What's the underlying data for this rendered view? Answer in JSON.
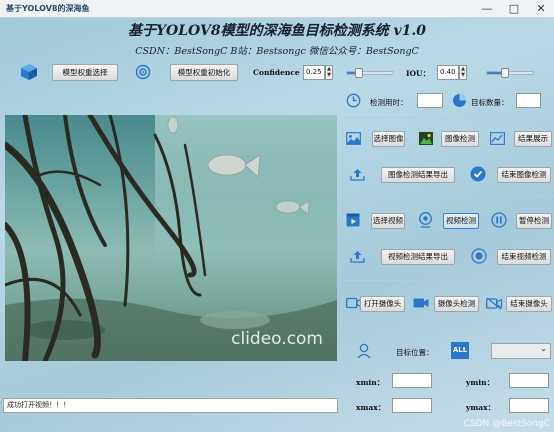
{
  "window": {
    "title": "基于YOLOV8的深海鱼",
    "min_glyph": "—",
    "max_glyph": "□",
    "close_glyph": "✕"
  },
  "header": {
    "title": "基于YOLOV8模型的深海鱼目标检测系统 v1.0",
    "subtitle": "CSDN：BestSongC   B站：Bestsongc   微信公众号：BestSongC"
  },
  "toolbar": {
    "select_weights": "模型权重选择",
    "init_weights": "模型权重初始化",
    "confidence_label": "Confidence",
    "confidence_value": "0.25",
    "confidence_level": 0.25,
    "iou_label": "IOU：",
    "iou_value": "0.40",
    "iou_level": 0.4
  },
  "stats": {
    "time_label": "检测用时：",
    "time_value": "",
    "count_label": "目标数量：",
    "count_value": ""
  },
  "image_section": {
    "select_image": "选择图像",
    "detect_image": "图像检测",
    "show_results": "结果展示",
    "export_image_results": "图像检测结果导出",
    "end_image_detection": "结束图像检测"
  },
  "video_section": {
    "select_video": "选择视频",
    "detect_video": "视频检测",
    "pause_detection": "暂停检测",
    "export_video_results": "视频检测结果导出",
    "end_video_detection": "结束视频检测"
  },
  "camera_section": {
    "open_camera": "打开摄像头",
    "detect_camera": "摄像头检测",
    "close_camera": "结束摄像头"
  },
  "position_section": {
    "target_position_label": "目标位置：",
    "all_badge": "ALL",
    "select_value": "⌄",
    "xmin_label": "xmin：",
    "xmin_value": "",
    "ymin_label": "ymin：",
    "ymin_value": "",
    "xmax_label": "xmax：",
    "xmax_value": "",
    "ymax_label": "ymax：",
    "ymax_value": ""
  },
  "video_panel": {
    "watermark": "clideo.com"
  },
  "status_bar": {
    "text": "成功打开视频！！！"
  },
  "footer": {
    "csdn_watermark": "CSDN @BestSongC"
  },
  "colors": {
    "accent_blue": "#3a7fd0",
    "background": "#a6cadb"
  }
}
